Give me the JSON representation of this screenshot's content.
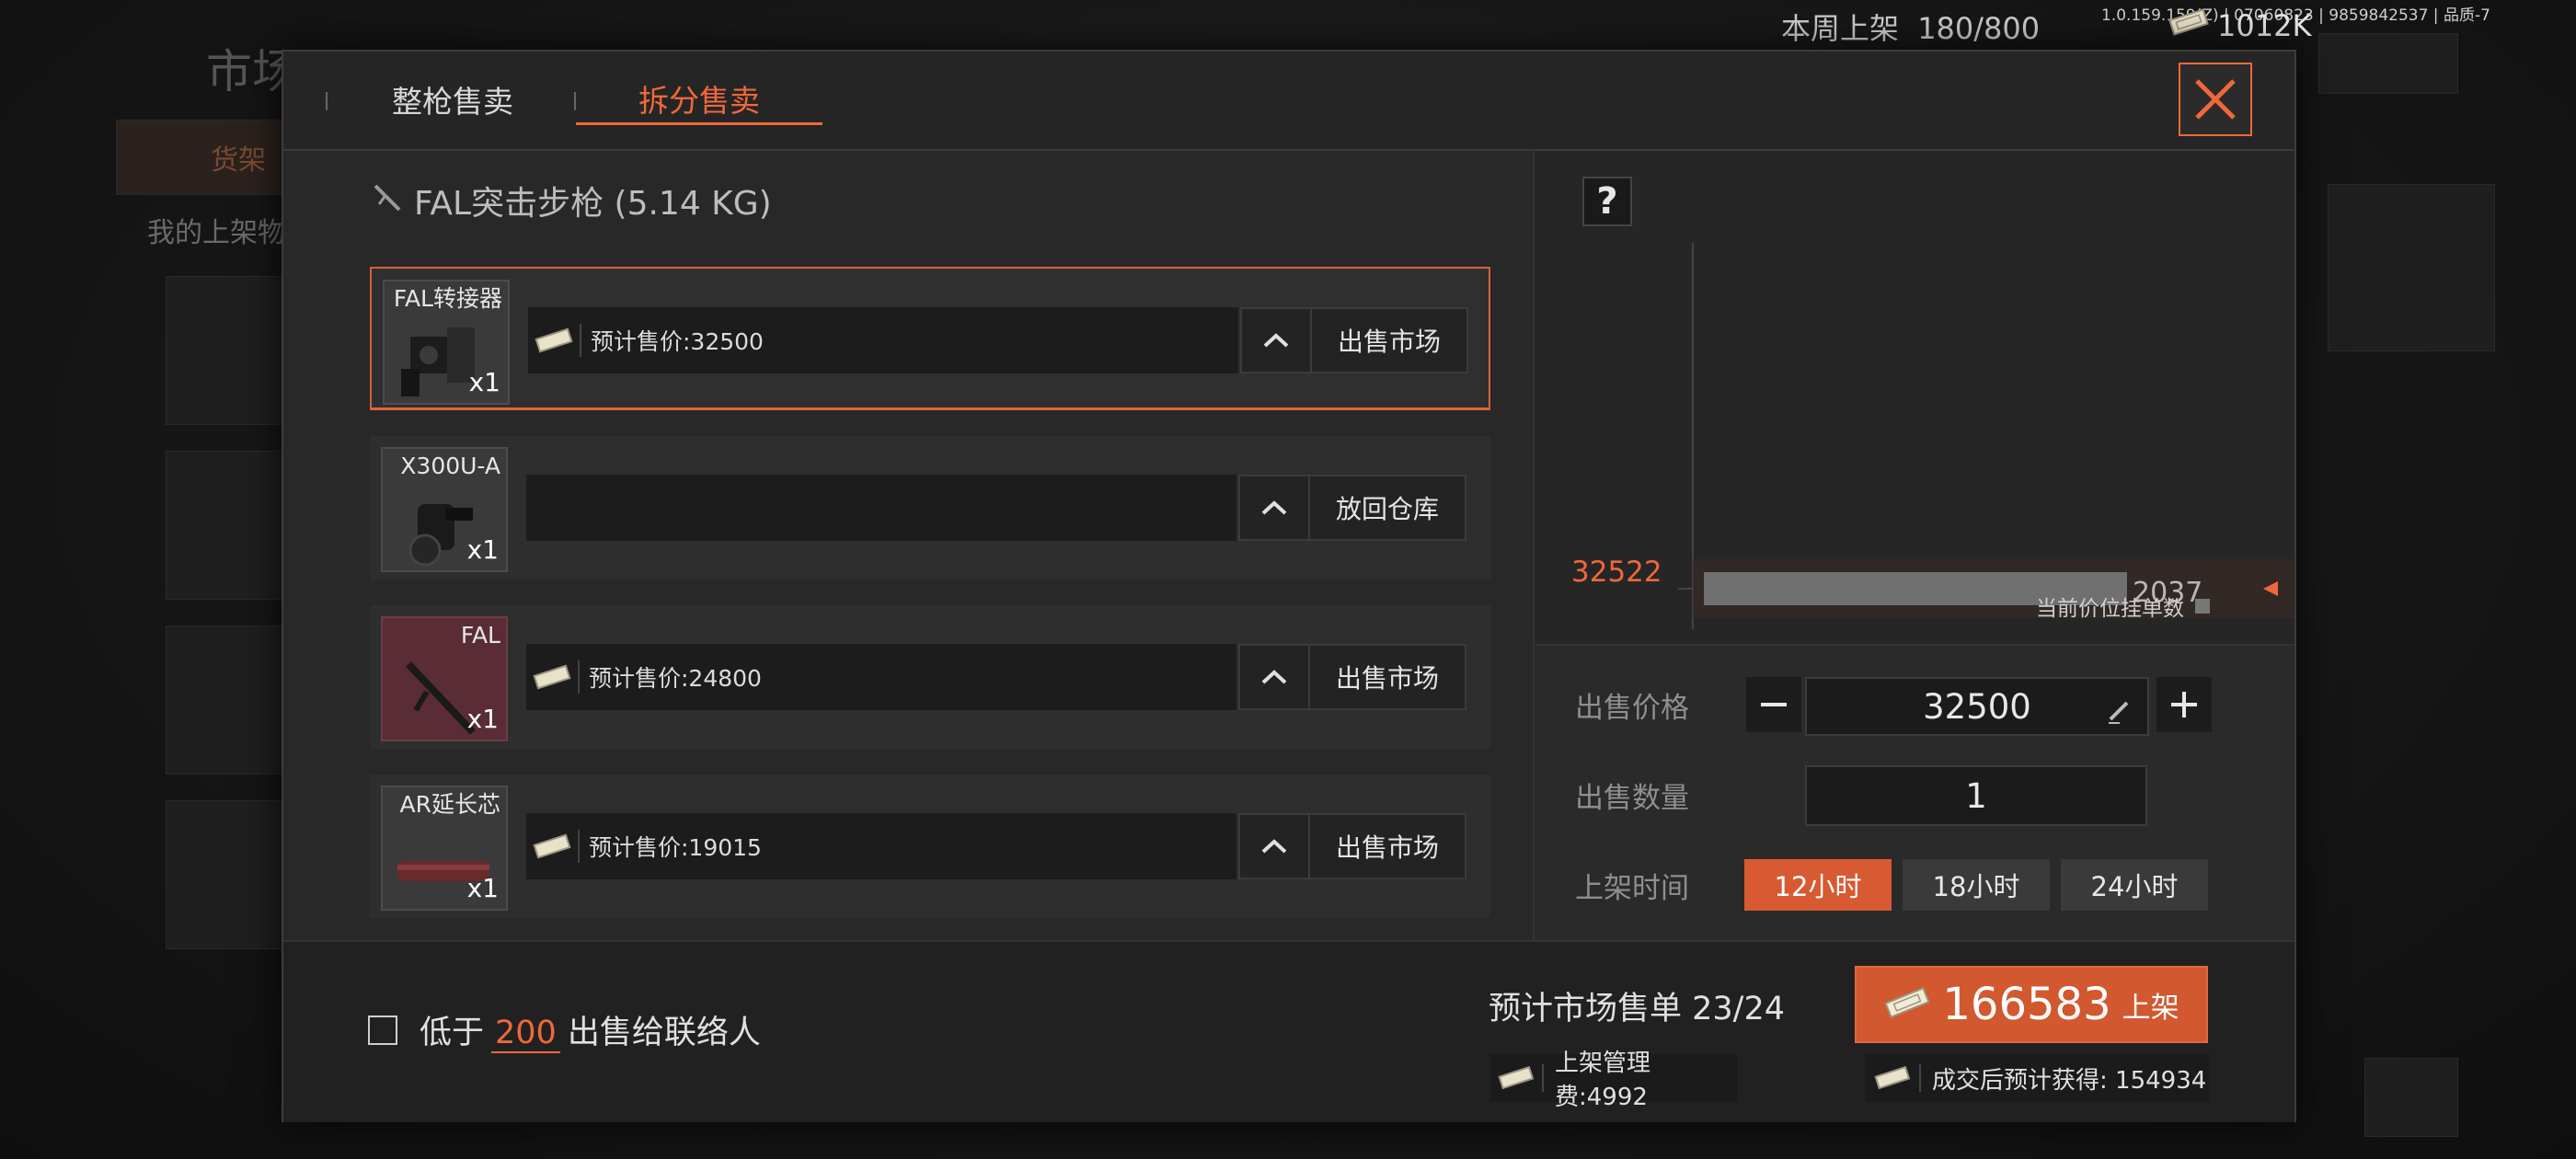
{
  "hud": {
    "weekly_label": "本周上架",
    "weekly_count": "180/800",
    "version_text": "1.0.159.159(Z) | 07060823 | 9859842537 | 品质-7",
    "currency": "1012K"
  },
  "background": {
    "title": "市场",
    "shelf_tab": "货架",
    "my_listings": "我的上架物"
  },
  "tabs": {
    "whole": "整枪售卖",
    "split": "拆分售卖"
  },
  "weapon_title": "FAL突击步枪 (5.14 KG)",
  "items": [
    {
      "name": "FAL转接器",
      "qty": "x1",
      "price": "预计售价:32500",
      "action": "出售市场"
    },
    {
      "name": "X300U-A",
      "qty": "x1",
      "price": "",
      "action": "放回仓库"
    },
    {
      "name": "FAL",
      "qty": "x1",
      "price": "预计售价:24800",
      "action": "出售市场"
    },
    {
      "name": "AR延长芯",
      "qty": "x1",
      "price": "预计售价:19015",
      "action": "出售市场"
    }
  ],
  "chart_data": {
    "type": "bar",
    "categories": [
      "32522"
    ],
    "values": [
      2037
    ],
    "orientation": "horizontal",
    "title": "",
    "xlabel": "",
    "ylabel": "",
    "legend": "当前价位挂单数",
    "accent_color": "#f0683a"
  },
  "form": {
    "price_label": "出售价格",
    "price_value": "32500",
    "qty_label": "出售数量",
    "qty_value": "1",
    "time_label": "上架时间",
    "time_options": [
      "12小时",
      "18小时",
      "24小时"
    ],
    "time_selected": "12小时"
  },
  "footer": {
    "contact_prefix": "低于",
    "contact_value": "200",
    "contact_suffix": "出售给联络人",
    "orders_text": "预计市场售单 23/24",
    "list_amount": "166583",
    "list_label": "上架",
    "fee_text": "上架管理费:4992",
    "net_text": "成交后预计获得: 154934"
  },
  "icons": [
    "cash-icon",
    "close-icon",
    "help-icon",
    "chevron-up-icon",
    "minus-icon",
    "plus-icon",
    "edit-icon",
    "rifle-icon"
  ]
}
